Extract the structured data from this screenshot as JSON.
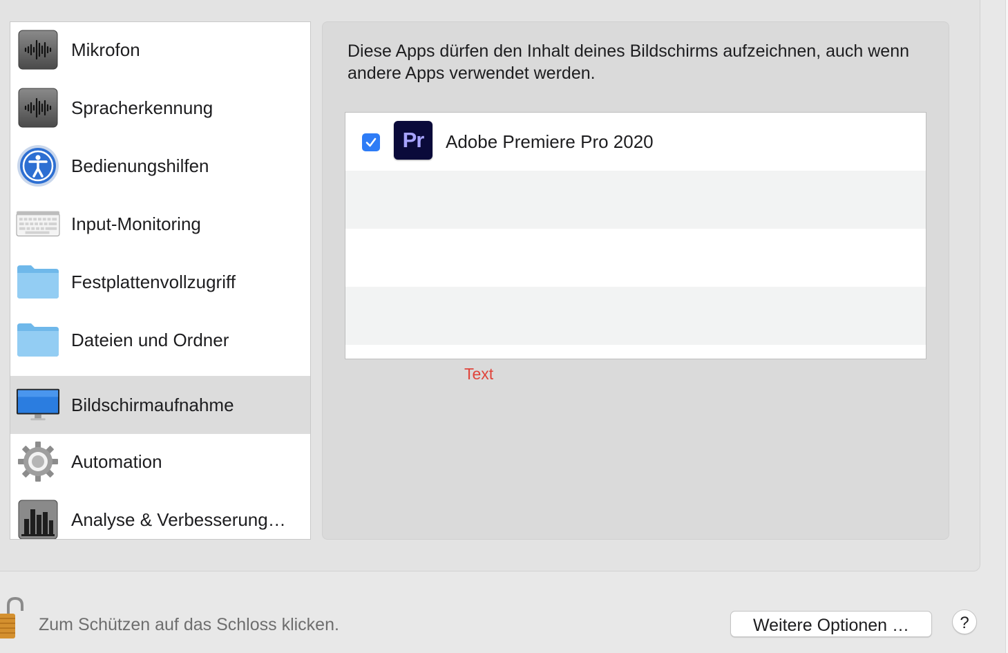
{
  "sidebar": {
    "items": [
      {
        "label": "Mikrofon",
        "icon": "microphone-waveform-icon",
        "selected": false
      },
      {
        "label": "Spracherkennung",
        "icon": "speech-waveform-icon",
        "selected": false
      },
      {
        "label": "Bedienungshilfen",
        "icon": "accessibility-icon",
        "selected": false
      },
      {
        "label": "Input-Monitoring",
        "icon": "keyboard-icon",
        "selected": false
      },
      {
        "label": "Festplattenvollzugriff",
        "icon": "folder-icon",
        "selected": false
      },
      {
        "label": "Dateien und Ordner",
        "icon": "folder-icon",
        "selected": false
      },
      {
        "label": "Bildschirmaufnahme",
        "icon": "display-icon",
        "selected": true
      },
      {
        "label": "Automation",
        "icon": "gear-icon",
        "selected": false
      },
      {
        "label": "Analyse & Verbesserung…",
        "icon": "bar-chart-icon",
        "selected": false
      }
    ]
  },
  "detail": {
    "description": "Diese Apps dürfen den Inhalt deines Bildschirms aufzeichnen, auch wenn andere Apps verwendet werden.",
    "apps": [
      {
        "name": "Adobe Premiere Pro 2020",
        "icon_text": "Pr",
        "checked": true
      }
    ],
    "red_label": "Text"
  },
  "footer": {
    "lock_text": "Zum Schützen auf das Schloss klicken.",
    "options_button": "Weitere Optionen …",
    "help_button": "?"
  },
  "colors": {
    "checkbox_blue": "#2e7cf6",
    "premiere_bg": "#0a0a3a",
    "premiere_text": "#a7a4ff",
    "red_label": "#e0443b",
    "selection": "#dcdcdc"
  }
}
